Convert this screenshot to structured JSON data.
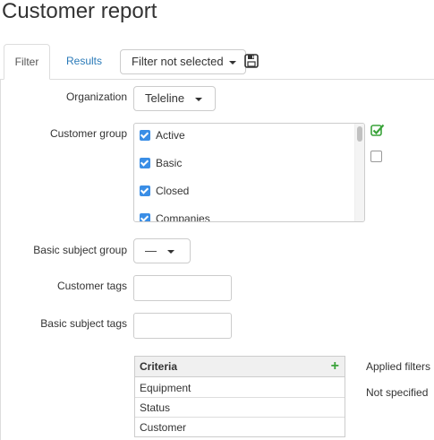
{
  "page": {
    "title": "Customer report"
  },
  "tabs": [
    {
      "label": "Filter",
      "active": true
    },
    {
      "label": "Results",
      "active": false
    }
  ],
  "filter_select": {
    "label": "Filter not selected"
  },
  "icons": {
    "save": "floppy-disk-icon",
    "select_all": "green-checkmark-icon",
    "add": "plus-icon",
    "dropdown": "caret-down-icon"
  },
  "colors": {
    "accent": "#3a8ee6",
    "link": "#2a7ab8",
    "add": "#3aa33a"
  },
  "form": {
    "organization": {
      "label": "Organization",
      "value": "Teleline"
    },
    "customer_group": {
      "label": "Customer group",
      "items": [
        {
          "label": "Active",
          "checked": true
        },
        {
          "label": "Basic",
          "checked": true
        },
        {
          "label": "Closed",
          "checked": true
        },
        {
          "label": "Companies",
          "checked": true
        }
      ]
    },
    "basic_subject_group": {
      "label": "Basic subject group",
      "value": "—"
    },
    "customer_tags": {
      "label": "Customer tags",
      "value": ""
    },
    "basic_subject_tags": {
      "label": "Basic subject tags",
      "value": ""
    }
  },
  "criteria": {
    "header": "Criteria",
    "add_symbol": "+",
    "rows": [
      "Equipment",
      "Status",
      "Customer"
    ]
  },
  "applied_filters": {
    "label": "Applied filters",
    "value": "Not specified"
  }
}
